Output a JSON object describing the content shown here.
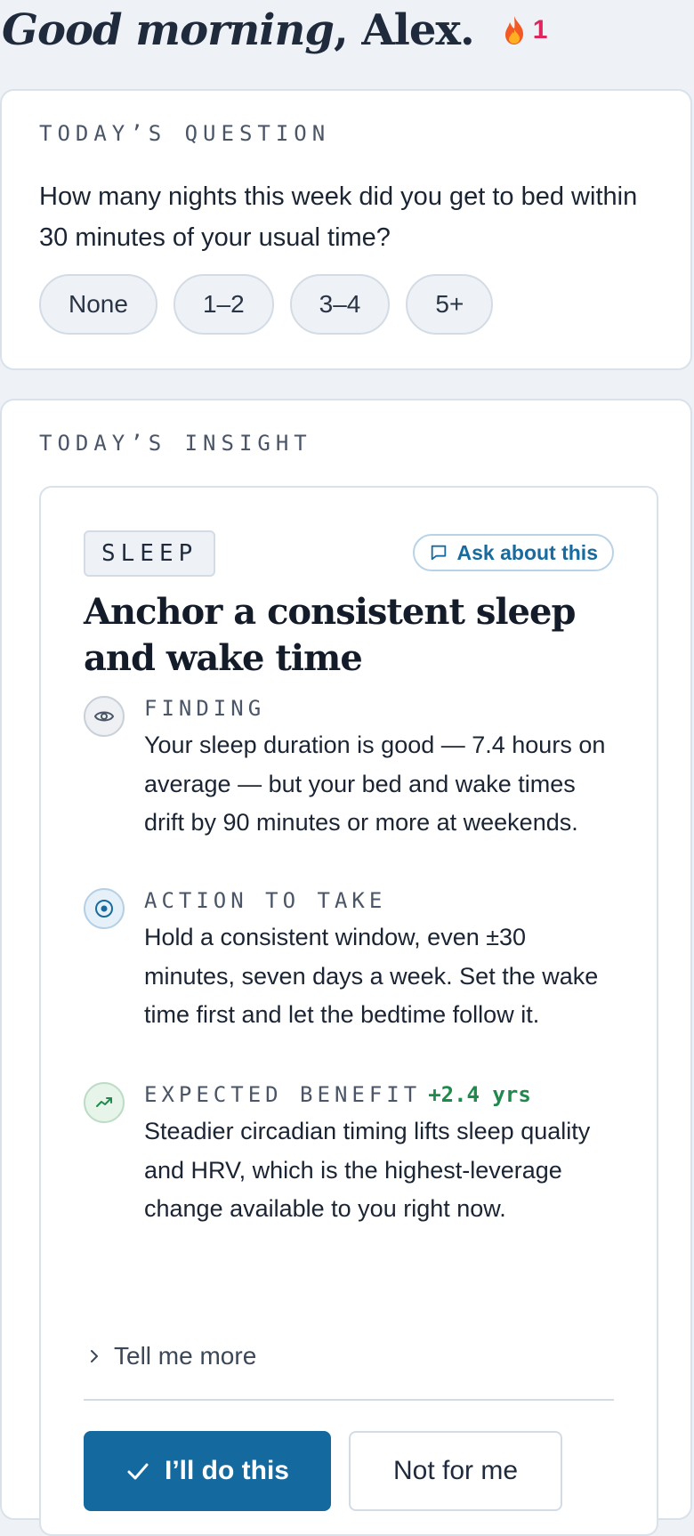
{
  "header": {
    "greeting": "Good morning",
    "name": ", Alex.",
    "streak_count": "1"
  },
  "question_card": {
    "eyebrow": "TODAY’S QUESTION",
    "question": "How many nights this week did you get to bed within 30 minutes of your usual time?",
    "options": [
      "None",
      "1–2",
      "3–4",
      "5+"
    ]
  },
  "insight_card": {
    "eyebrow": "TODAY’S INSIGHT",
    "tag": "SLEEP",
    "ask_label": "Ask about this",
    "title": "Anchor a consistent sleep and wake time",
    "finding": {
      "label": "FINDING",
      "text": "Your sleep duration is good — 7.4 hours on average — but your bed and wake times drift by 90 minutes or more at weekends."
    },
    "action": {
      "label": "ACTION TO TAKE",
      "text": "Hold a consistent window, even ±30 minutes, seven days a week. Set the wake time first and let the bedtime follow it."
    },
    "benefit": {
      "label": "EXPECTED BENEFIT",
      "gain": "+2.4 yrs",
      "text": "Steadier circadian timing lifts sleep quality and HRV, which is the highest-leverage change available to you right now."
    },
    "more_label": "Tell me more",
    "accept_label": "I’ll do this",
    "decline_label": "Not for me"
  },
  "colors": {
    "accent": "#14699f",
    "streak": "#e0245e",
    "gain": "#1f8a4c",
    "background": "#eef2f6"
  },
  "icons": {
    "streak": "flame-icon",
    "ask": "chat-bubble-icon",
    "finding": "eye-icon",
    "action": "target-icon",
    "benefit": "trending-up-icon",
    "more": "chevron-right-icon",
    "accept": "check-icon"
  }
}
